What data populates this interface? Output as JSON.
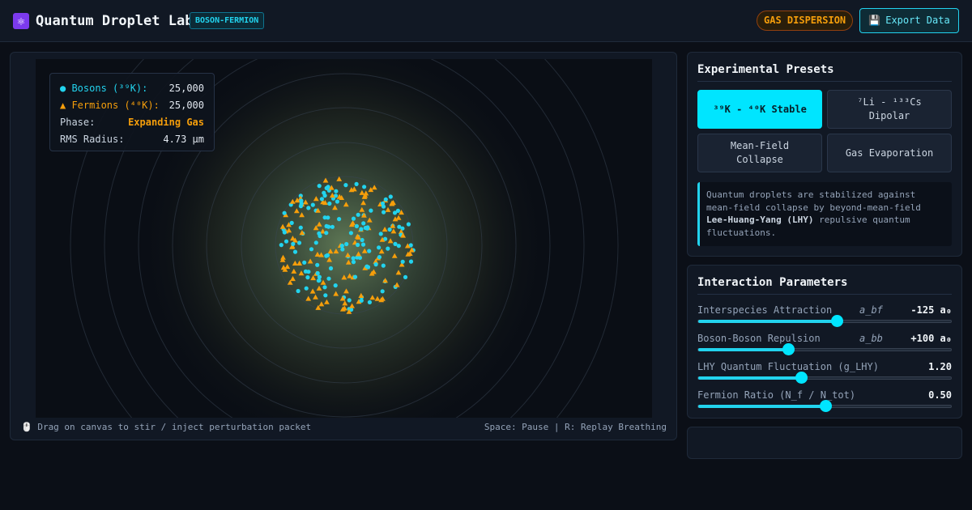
{
  "header": {
    "title": "Quantum Droplet Lab",
    "logo_icon": "atom-icon",
    "mode_badge": "BOSON-FERMION",
    "phase_pill": "GAS DISPERSION",
    "export_label": "Export Data",
    "export_icon": "floppy-disk-icon"
  },
  "readout": {
    "bosons_label": "● Bosons (³⁹K):",
    "bosons_value": "25,000",
    "fermions_label": "▲ Fermions (⁴⁰K):",
    "fermions_value": "25,000",
    "phase_label": "Phase:",
    "phase_value": "Expanding Gas",
    "rms_label": "RMS Radius:",
    "rms_value": "4.73 µm"
  },
  "canvas": {
    "hint_left": "🖱️ Drag on canvas to stir / inject perturbation packet",
    "hint_right": "Space: Pause | R: Replay Breathing",
    "boson_color": "#22d3ee",
    "fermion_color": "#f59e0b"
  },
  "presets": {
    "title": "Experimental Presets",
    "items": [
      {
        "label": "³⁹K - ⁴⁰K Stable",
        "active": true
      },
      {
        "label": "⁷Li - ¹³³Cs Dipolar",
        "active": false
      },
      {
        "label": "Mean-Field Collapse",
        "active": false
      },
      {
        "label": "Gas Evaporation",
        "active": false
      }
    ],
    "info_pre": "Quantum droplets are stabilized against mean-field collapse by beyond-mean-field ",
    "info_bold": "Lee-Huang-Yang (LHY)",
    "info_post": " repulsive quantum fluctuations."
  },
  "parameters": {
    "title": "Interaction Parameters",
    "items": [
      {
        "name": "Interspecies Attraction",
        "symbol": "a_bf",
        "value": "-125 a₀",
        "fraction": 0.545
      },
      {
        "name": "Boson-Boson Repulsion",
        "symbol": "a_bb",
        "value": "+100 a₀",
        "fraction": 0.355
      },
      {
        "name": "LHY Quantum Fluctuation (g_LHY)",
        "symbol": "",
        "value": "1.20",
        "fraction": 0.405
      },
      {
        "name": "Fermion Ratio (N_f / N_tot)",
        "symbol": "",
        "value": "0.50",
        "fraction": 0.5
      }
    ]
  }
}
